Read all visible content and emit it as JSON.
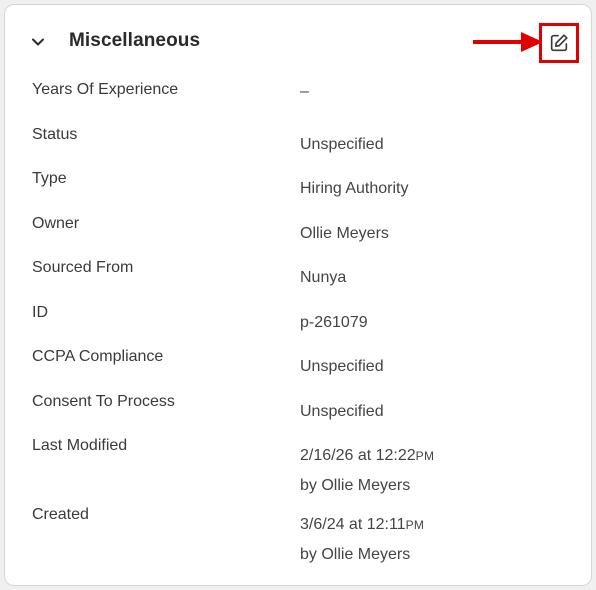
{
  "section": {
    "title": "Miscellaneous",
    "edit_icon": "edit-icon",
    "collapse_icon": "chevron-down-icon",
    "accent_color": "#e00000"
  },
  "fields": {
    "years_of_experience": {
      "label": "Years Of Experience",
      "value": "–"
    },
    "status": {
      "label": "Status",
      "value": "Unspecified"
    },
    "type": {
      "label": "Type",
      "value": "Hiring Authority"
    },
    "owner": {
      "label": "Owner",
      "value": "Ollie Meyers"
    },
    "sourced_from": {
      "label": "Sourced From",
      "value": "Nunya"
    },
    "id": {
      "label": "ID",
      "value": "p-261079"
    },
    "ccpa_compliance": {
      "label": "CCPA Compliance",
      "value": "Unspecified"
    },
    "consent_to_process": {
      "label": "Consent To Process",
      "value": "Unspecified"
    },
    "last_modified": {
      "label": "Last Modified",
      "date_time": "2/16/26 at 12:22",
      "meridiem": "PM",
      "by": "by Ollie Meyers"
    },
    "created": {
      "label": "Created",
      "date_time": "3/6/24 at 12:11",
      "meridiem": "PM",
      "by": "by Ollie Meyers"
    }
  }
}
